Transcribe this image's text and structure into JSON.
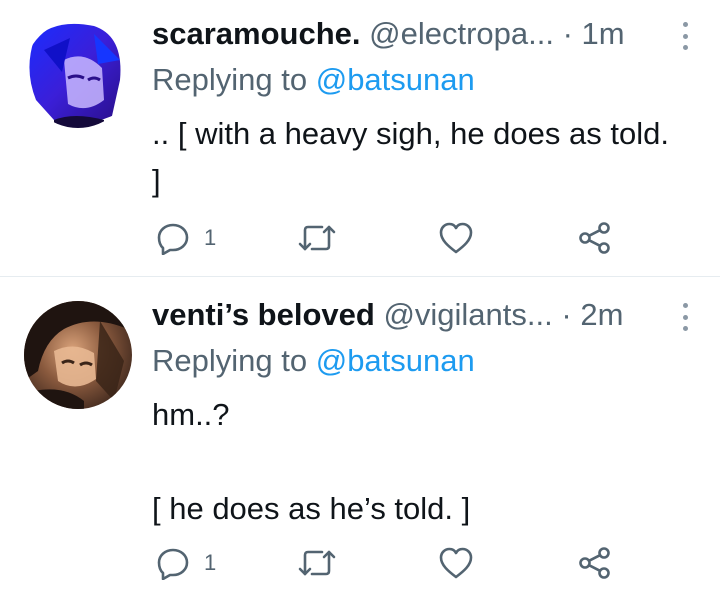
{
  "tweets": [
    {
      "name": "scaramouche.",
      "handle": "@electropa...",
      "separator": "·",
      "time": "1m",
      "replying_prefix": "Replying to",
      "replying_to": "@batsunan",
      "body_lines": [
        ".. [ with a heavy sigh, he does as told. ]"
      ],
      "reply_count": "1"
    },
    {
      "name": "venti’s beloved",
      "handle": "@vigilants...",
      "separator": "·",
      "time": "2m",
      "replying_prefix": "Replying to",
      "replying_to": "@batsunan",
      "body_lines": [
        "hm..?",
        "[ he does as he’s told. ]"
      ],
      "reply_count": "1"
    }
  ],
  "icons": {
    "reply": "speech-bubble-icon",
    "retweet": "retweet-icon",
    "like": "heart-icon",
    "share": "share-icon",
    "more": "vertical-dots-icon"
  },
  "colors": {
    "mention": "#1d9bf0",
    "secondary_text": "#536471",
    "primary_text": "#0f1419",
    "divider": "#e6ecf0"
  }
}
